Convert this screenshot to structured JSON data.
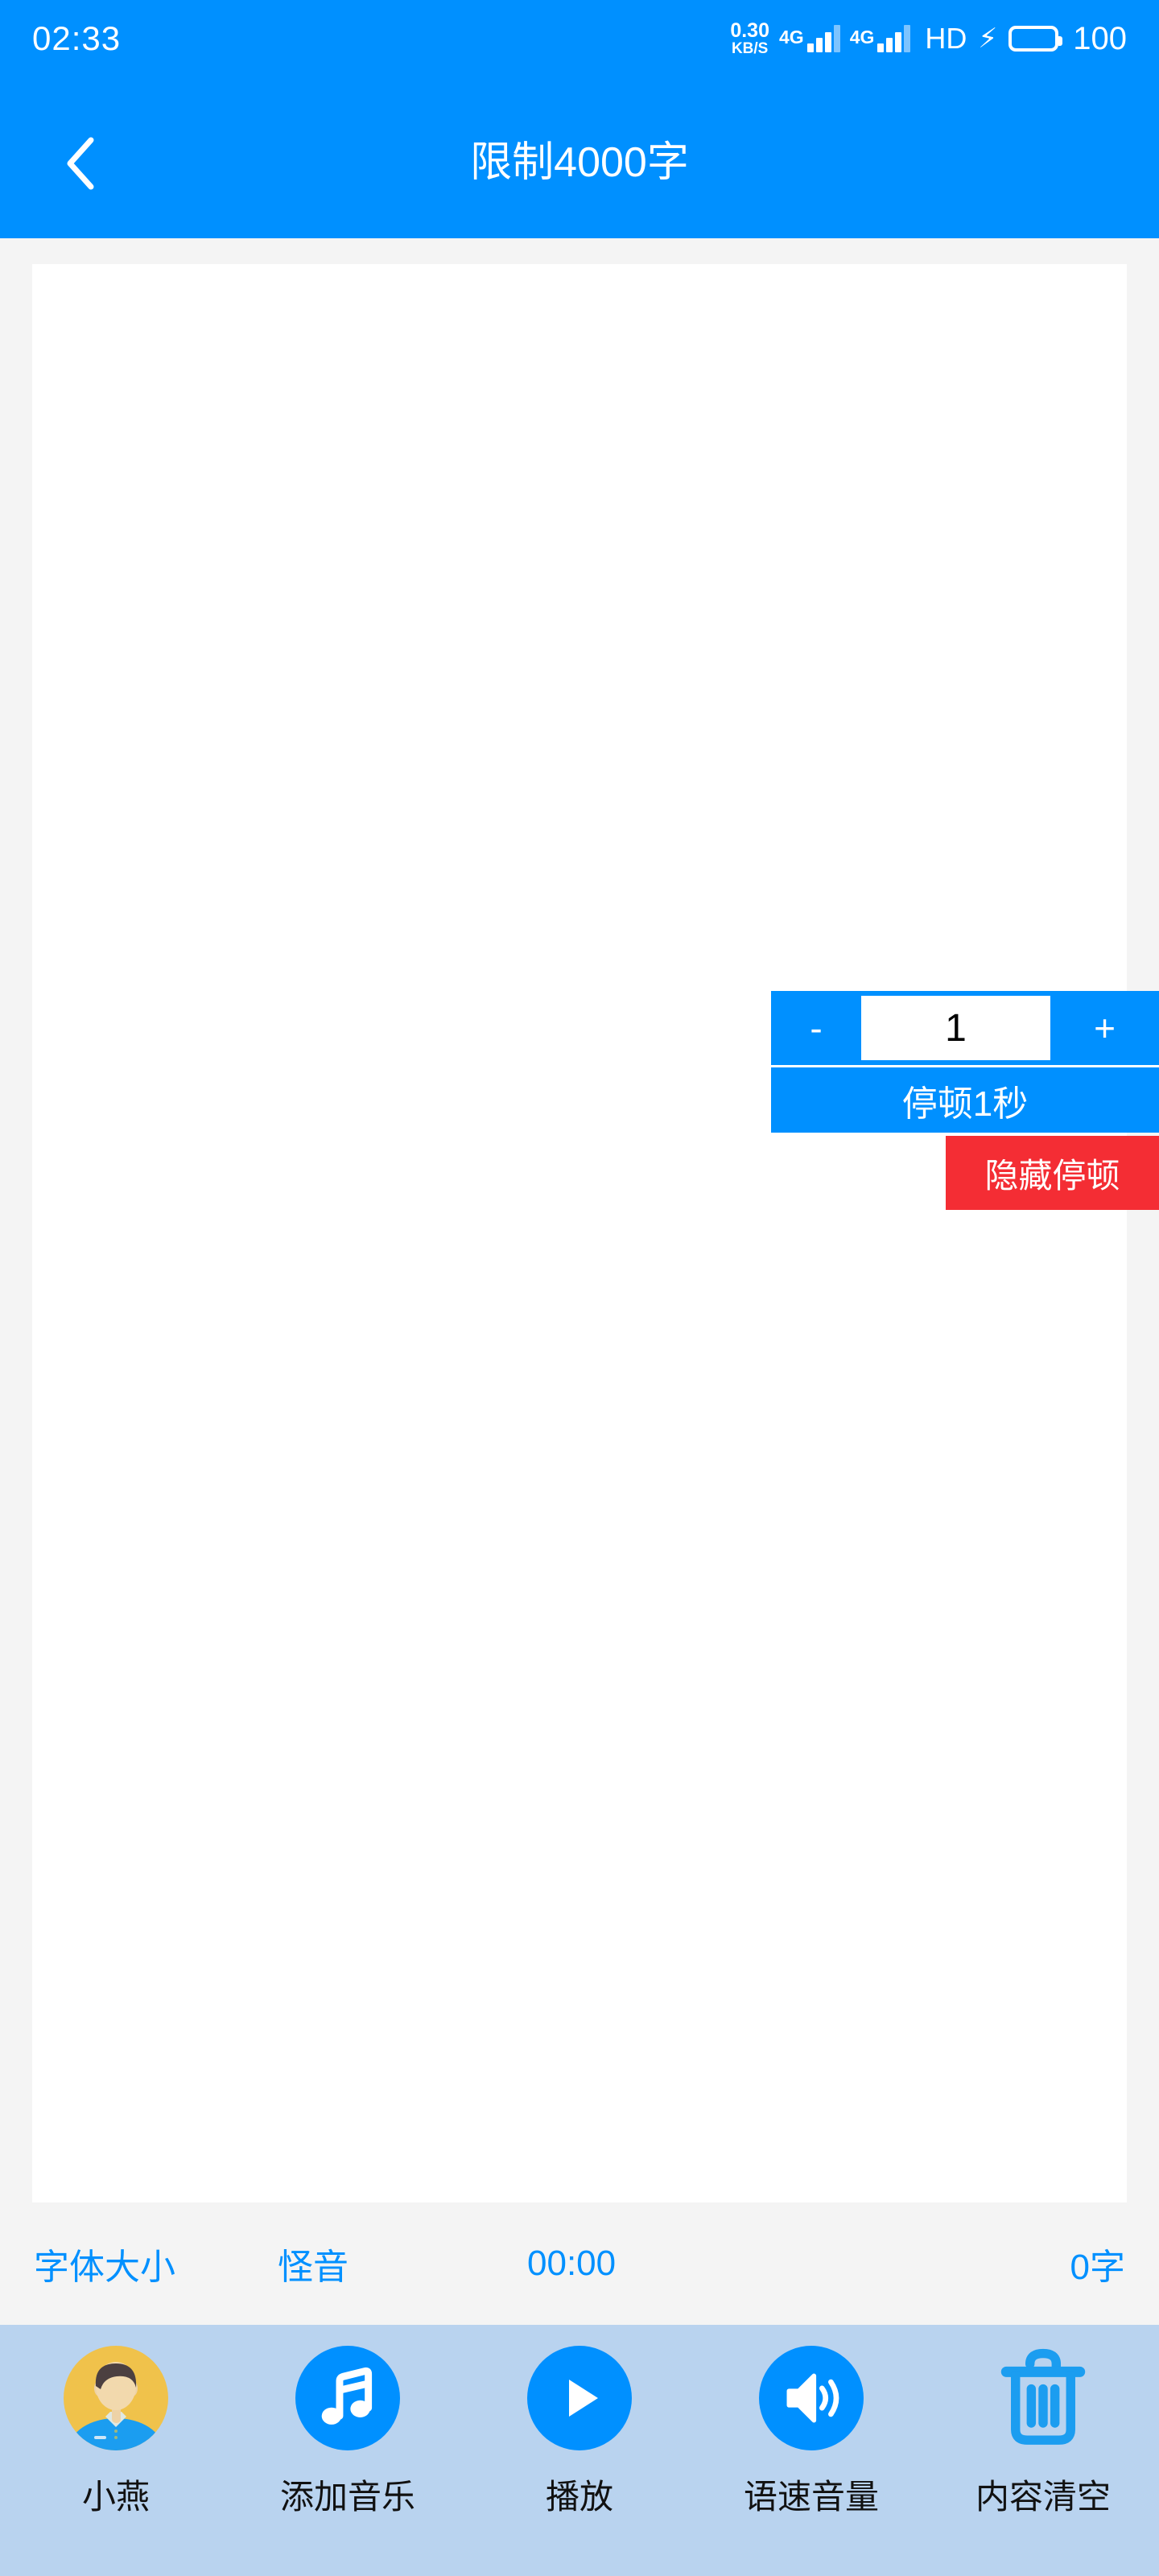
{
  "statusbar": {
    "clock": "02:33",
    "net_speed_value": "0.30",
    "net_speed_unit": "KB/S",
    "sim1_network": "4G",
    "sim2_network": "4G",
    "hd_label": "HD",
    "charging_icon": "bolt-icon",
    "battery_percent": "100"
  },
  "navbar": {
    "back_icon": "back-chevron-icon",
    "title": "限制4000字"
  },
  "editor": {
    "text": "",
    "placeholder": ""
  },
  "pause_widget": {
    "decrement_label": "-",
    "value": "1",
    "increment_label": "+",
    "pause_label": "停顿1秒",
    "hide_label": "隐藏停顿",
    "accent_color": "#0090ff",
    "hide_color": "#f42d34"
  },
  "stats": {
    "font_size_label": "字体大小",
    "voice_label": "怪音",
    "time": "00:00",
    "word_count": "0字",
    "color": "#0090ff"
  },
  "toolbar": {
    "items": [
      {
        "label": "小燕",
        "icon": "avatar-icon"
      },
      {
        "label": "添加音乐",
        "icon": "music-note-icon"
      },
      {
        "label": "播放",
        "icon": "play-icon"
      },
      {
        "label": "语速音量",
        "icon": "speaker-volume-icon"
      },
      {
        "label": "内容清空",
        "icon": "trash-icon"
      }
    ],
    "background_color": "#b9d3ef"
  }
}
